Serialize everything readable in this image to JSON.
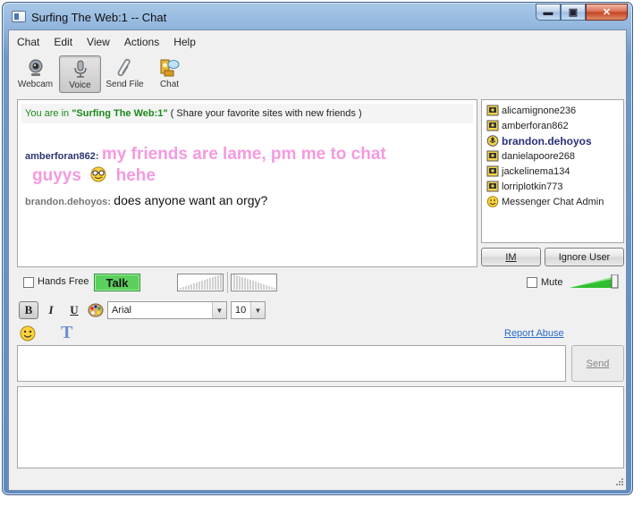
{
  "window": {
    "title": "Surfing The Web:1 -- Chat",
    "controls": {
      "minimize": "▬",
      "maximize": "▣",
      "close": "✕"
    }
  },
  "menu": [
    "Chat",
    "Edit",
    "View",
    "Actions",
    "Help"
  ],
  "toolbar": {
    "webcam": "Webcam",
    "voice": "Voice",
    "send_file": "Send File",
    "chat": "Chat"
  },
  "welcome": {
    "prefix": "You are in ",
    "room": "\"Surfing The Web:1\"",
    "topic": " ( Share your favorite sites with new friends )"
  },
  "messages": [
    {
      "nick": "amberforan862:",
      "text_line1": "my friends are lame, pm me to chat",
      "text_line2a": "guyys",
      "text_line2b": "hehe"
    },
    {
      "nick": "brandon.dehoyos:",
      "text": "does anyone want an orgy?"
    }
  ],
  "users": [
    {
      "name": "alicamignone236",
      "icon": "webcam-user-icon",
      "bold": false
    },
    {
      "name": "amberforan862",
      "icon": "webcam-user-icon",
      "bold": false
    },
    {
      "name": "brandon.dehoyos",
      "icon": "voice-user-icon",
      "bold": true
    },
    {
      "name": "danielapoore268",
      "icon": "webcam-user-icon",
      "bold": false
    },
    {
      "name": "jackelinema134",
      "icon": "webcam-user-icon",
      "bold": false
    },
    {
      "name": "lorriplotkin773",
      "icon": "webcam-user-icon",
      "bold": false
    },
    {
      "name": "Messenger Chat Admin",
      "icon": "smiley-icon",
      "bold": false
    }
  ],
  "buttons": {
    "im": "IM",
    "ignore": "Ignore User",
    "talk": "Talk",
    "send": "Send"
  },
  "voice": {
    "hands_free": "Hands Free",
    "mute": "Mute",
    "hands_free_checked": false,
    "mute_checked": false
  },
  "format": {
    "bold": "B",
    "italic": "I",
    "underline": "U",
    "font": "Arial",
    "size": "10",
    "text_style": "T"
  },
  "report_abuse": "Report Abuse",
  "colors": {
    "talk_green": "#5cd05c",
    "message_pink": "#f49ae0",
    "nick_blue": "#2b3570",
    "room_green": "#1a8a1a",
    "link_blue": "#2a6ac8"
  }
}
